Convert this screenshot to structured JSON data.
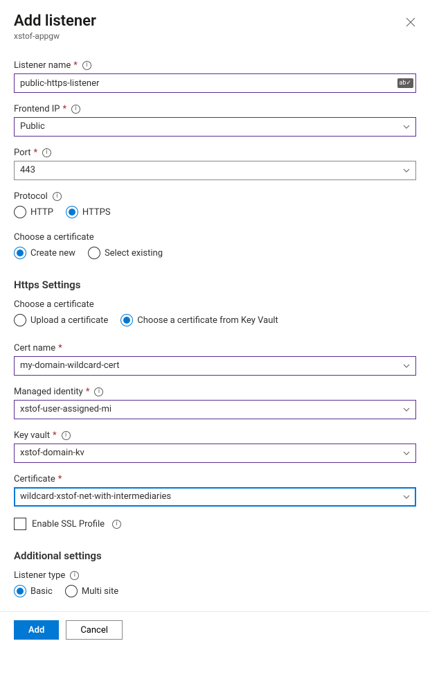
{
  "header": {
    "title": "Add listener",
    "subtitle": "xstof-appgw"
  },
  "fields": {
    "listener_name": {
      "label": "Listener name",
      "value": "public-https-listener"
    },
    "frontend_ip": {
      "label": "Frontend IP",
      "value": "Public"
    },
    "port": {
      "label": "Port",
      "value": "443"
    },
    "protocol": {
      "label": "Protocol",
      "option_http": "HTTP",
      "option_https": "HTTPS"
    },
    "choose_cert_mode": {
      "label": "Choose a certificate",
      "option_create": "Create new",
      "option_existing": "Select existing"
    },
    "https_settings_head": "Https Settings",
    "choose_cert_src": {
      "label": "Choose a certificate",
      "option_upload": "Upload a certificate",
      "option_kv": "Choose a certificate from Key Vault"
    },
    "cert_name": {
      "label": "Cert name",
      "value": "my-domain-wildcard-cert"
    },
    "managed_identity": {
      "label": "Managed identity",
      "value": "xstof-user-assigned-mi"
    },
    "key_vault": {
      "label": "Key vault",
      "value": "xstof-domain-kv"
    },
    "certificate": {
      "label": "Certificate",
      "value": "wildcard-xstof-net-with-intermediaries"
    },
    "enable_ssl": {
      "label": "Enable SSL Profile"
    },
    "additional_head": "Additional settings",
    "listener_type": {
      "label": "Listener type",
      "option_basic": "Basic",
      "option_multi": "Multi site"
    }
  },
  "footer": {
    "add": "Add",
    "cancel": "Cancel"
  }
}
